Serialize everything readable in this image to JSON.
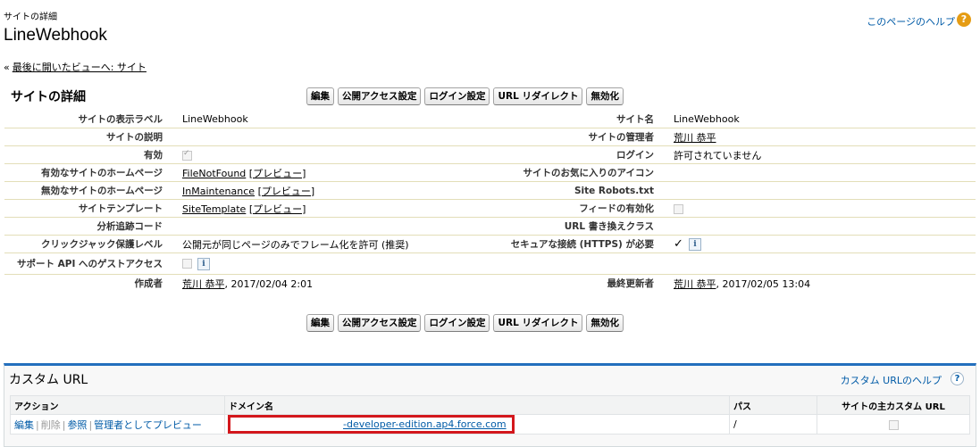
{
  "header": {
    "crumb": "サイトの詳細",
    "title": "LineWebhook",
    "help_label": "このページのヘルプ",
    "help_icon": "question-icon",
    "back_chevron": "«",
    "back_label": "最後に開いたビューへ: サイト"
  },
  "detail": {
    "section_title": "サイトの詳細",
    "buttons": [
      "編集",
      "公開アクセス設定",
      "ログイン設定",
      "URL リダイレクト",
      "無効化"
    ],
    "rows": [
      {
        "l1": "サイトの表示ラベル",
        "v1": "LineWebhook",
        "l2": "サイト名",
        "v2": "LineWebhook"
      },
      {
        "l1": "サイトの説明",
        "v1": "",
        "l2": "サイトの管理者",
        "v2": "荒川 恭平"
      },
      {
        "l1": "有効",
        "v1": "",
        "l2": "ログイン",
        "v2": "許可されていません"
      },
      {
        "l1": "有効なサイトのホームページ",
        "v1": "FileNotFound",
        "v1b": "[プレビュー]",
        "l2": "サイトのお気に入りのアイコン",
        "v2": ""
      },
      {
        "l1": "無効なサイトのホームページ",
        "v1": "InMaintenance",
        "v1b": "[プレビュー]",
        "l2": "Site Robots.txt",
        "v2": ""
      },
      {
        "l1": "サイトテンプレート",
        "v1": "SiteTemplate",
        "v1b": "[プレビュー]",
        "l2": "フィードの有効化",
        "v2": ""
      },
      {
        "l1": "分析追跡コード",
        "v1": "",
        "l2": "URL 書き換えクラス",
        "v2": ""
      },
      {
        "l1": "クリックジャック保護レベル",
        "v1": "公開元が同じページのみでフレーム化を許可 (推奨)",
        "l2": "セキュアな接続 (HTTPS) が必要",
        "v2": "✓"
      },
      {
        "l1": "サポート API へのゲストアクセス",
        "v1": "",
        "l2": "",
        "v2": ""
      },
      {
        "l1": "作成者",
        "v1": "荒川 恭平",
        "v1b": ", 2017/02/04 2:01",
        "l2": "最終更新者",
        "v2": "荒川 恭平",
        "v2b": ", 2017/02/05 13:04"
      }
    ],
    "info_icon_label": "i"
  },
  "custom_url": {
    "title": "カスタム URL",
    "help_label": "カスタム URLのヘルプ",
    "help_icon": "question-icon",
    "columns": [
      "アクション",
      "ドメイン名",
      "パス",
      "サイトの主カスタム URL"
    ],
    "row": {
      "actions": [
        "編集",
        "削除",
        "参照",
        "管理者としてプレビュー"
      ],
      "domain": "-developer-edition.ap4.force.com",
      "path": "/"
    }
  }
}
